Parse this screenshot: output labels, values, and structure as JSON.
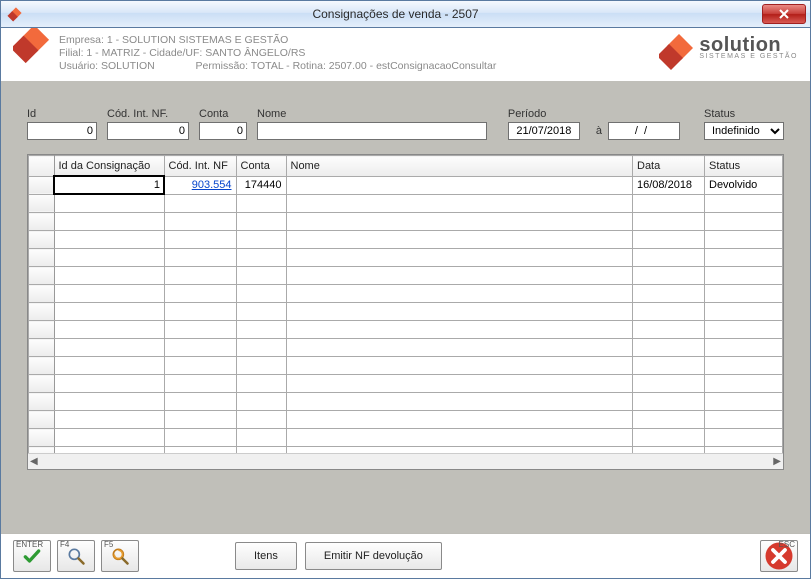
{
  "window": {
    "title": "Consignações de venda - 2507"
  },
  "header": {
    "empresa": "Empresa: 1 - SOLUTION SISTEMAS E GESTÃO",
    "filial": "Filial: 1 - MATRIZ - Cidade/UF: SANTO ÂNGELO/RS",
    "usuario": "Usuário: SOLUTION",
    "permissao": "Permissão: TOTAL - Rotina: 2507.00 - estConsignacaoConsultar",
    "brand": "solution",
    "brand_sub": "SISTEMAS E GESTÃO"
  },
  "filters": {
    "id_label": "Id",
    "id_value": "0",
    "codint_label": "Cód. Int. NF.",
    "codint_value": "0",
    "conta_label": "Conta",
    "conta_value": "0",
    "nome_label": "Nome",
    "nome_value": "",
    "periodo_label": "Período",
    "periodo_from": "21/07/2018",
    "periodo_sep": "à",
    "periodo_to": "  /  /    ",
    "status_label": "Status",
    "status_value": "Indefinido"
  },
  "grid": {
    "headers": {
      "c1": "Id da Consignação",
      "c2": "Cód. Int. NF",
      "c3": "Conta",
      "c4": "Nome",
      "c5": "Data",
      "c6": "Status"
    },
    "row": {
      "id": "1",
      "codint": "903.554",
      "conta": "174440",
      "nome": "",
      "data": "16/08/2018",
      "status": "Devolvido"
    }
  },
  "footer": {
    "enter_key": "ENTER",
    "f4_key": "F4",
    "f5_key": "F5",
    "btn_itens": "Itens",
    "btn_emitir": "Emitir NF devolução",
    "esc_key": "ESC"
  },
  "colors": {
    "accent": "#f26a3c"
  }
}
